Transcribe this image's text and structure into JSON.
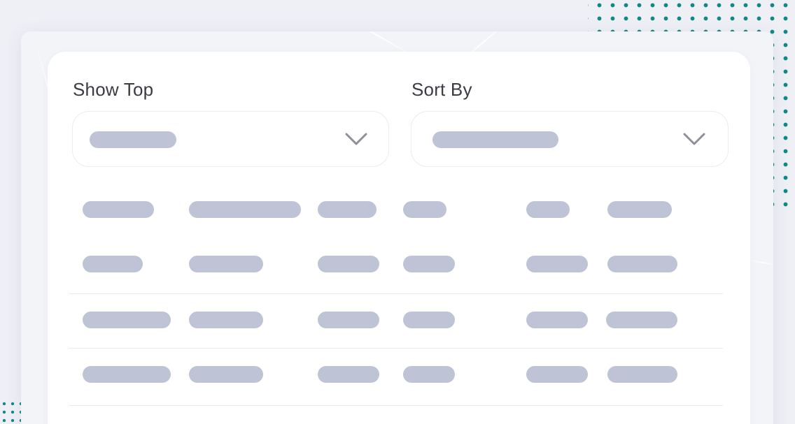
{
  "filters": {
    "show_top_label": "Show Top",
    "sort_by_label": "Sort By"
  },
  "icons": {
    "dropdown": "chevron-down-icon"
  },
  "colors": {
    "skeleton": "#bec3d5",
    "accent_dots": "#0f8a85",
    "chevron": "#8f8f98"
  },
  "table": {
    "loading": true,
    "rows": 4,
    "columns": 6
  }
}
